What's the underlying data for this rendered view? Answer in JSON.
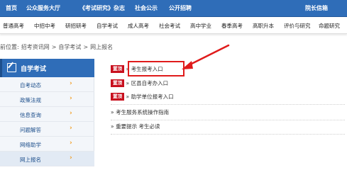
{
  "top_nav": [
    "首页",
    "公众服务大厅",
    "《考试研究》杂志",
    "社会公示",
    "公开招聘",
    "院长信箱"
  ],
  "sub_nav": [
    "普通高考",
    "中招中考",
    "研招研考",
    "自学考试",
    "成人高考",
    "社会考试",
    "高中学业",
    "春季高考",
    "高职升本",
    "评价与研究",
    "命题研究"
  ],
  "breadcrumb": {
    "prefix": "前位置:",
    "items": [
      "招考资讯网",
      "自学考试",
      "网上报名"
    ],
    "sep": ">"
  },
  "sidebar": {
    "title": "自学考试",
    "items": [
      {
        "label": "自考动态"
      },
      {
        "label": "政策法规"
      },
      {
        "label": "信息查询"
      },
      {
        "label": "问题解答"
      },
      {
        "label": "网络助学"
      },
      {
        "label": "网上报名"
      }
    ],
    "arrow": "›"
  },
  "main": {
    "links": [
      {
        "badge": "置顶",
        "prefix": "»",
        "text": "考生报考入口"
      },
      {
        "badge": "置顶",
        "prefix": "»",
        "text": "区县自考办入口"
      },
      {
        "badge": "置顶",
        "prefix": "»",
        "text": "助学单位报考入口"
      },
      {
        "badge": "",
        "prefix": "»",
        "text": "考生服务系统操作指南"
      },
      {
        "badge": "",
        "prefix": "»",
        "text": "重要提示 考生必读"
      }
    ]
  },
  "colors": {
    "nav_blue": "#2f6db8",
    "badge_red": "#c8101e",
    "highlight_red": "#e01b1b",
    "arrow_orange": "#f29a1a"
  }
}
